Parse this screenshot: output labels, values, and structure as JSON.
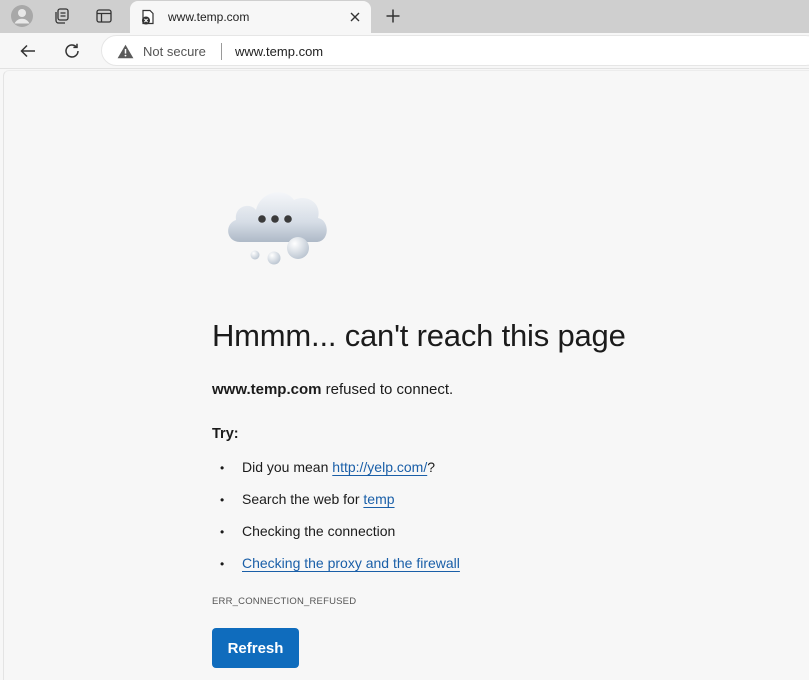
{
  "tab": {
    "title": "www.temp.com"
  },
  "omnibox": {
    "security_label": "Not secure",
    "url": "www.temp.com"
  },
  "error": {
    "headline": "Hmmm... can't reach this page",
    "host": "www.temp.com",
    "refused_text": " refused to connect.",
    "try_label": "Try:",
    "suggestions": [
      {
        "prefix": "Did you mean ",
        "link": "http://yelp.com/",
        "suffix": "?"
      },
      {
        "prefix": "Search the web for ",
        "link": "temp",
        "suffix": ""
      },
      {
        "prefix": "Checking the connection",
        "link": "",
        "suffix": ""
      },
      {
        "prefix": "",
        "link": "Checking the proxy and the firewall",
        "suffix": ""
      }
    ],
    "code": "ERR_CONNECTION_REFUSED",
    "refresh_label": "Refresh"
  },
  "icons": {
    "profile": "profile-icon",
    "workspaces": "workspaces-icon",
    "tab_actions": "vertical-tabs-icon",
    "back": "back-arrow-icon",
    "reload": "reload-icon",
    "warning": "warning-triangle-icon",
    "new_tab": "plus-icon",
    "close": "close-icon"
  },
  "colors": {
    "accent": "#0f6cbd",
    "link": "#1a5fa8",
    "tabstrip": "#cfcfcf",
    "page_bg": "#f7f7f7"
  }
}
